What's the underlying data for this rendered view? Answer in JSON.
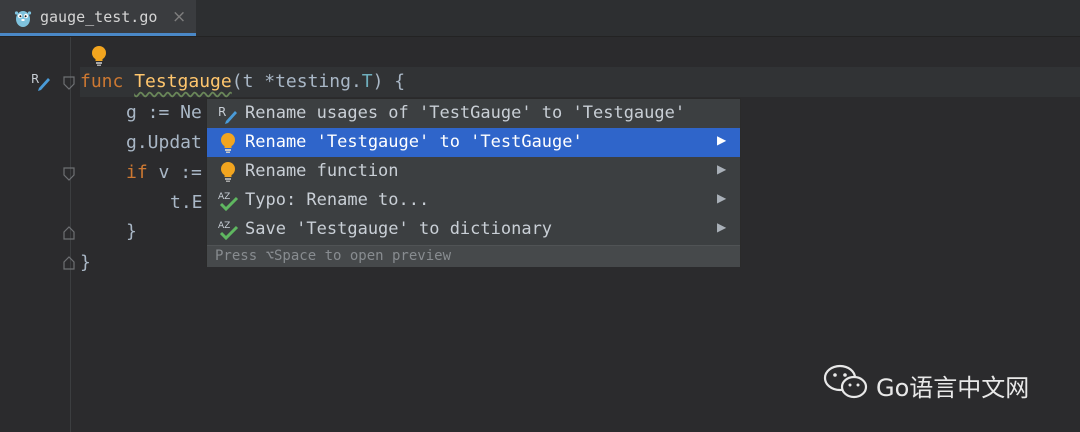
{
  "tab": {
    "filename": "gauge_test.go",
    "close_glyph": "×",
    "icon": "gopher-icon"
  },
  "editor": {
    "lines": {
      "l1_kw": "func ",
      "l1_fn": "Testgauge",
      "l1_a": "(t *testing.",
      "l1_ty": "T",
      "l1_b": ") {",
      "l2": "g := Ne",
      "l3": "g.Updat",
      "l4_kw": "if",
      "l4_rest": " v :=",
      "l5": "t.E",
      "l6": "}",
      "l7": "}"
    },
    "gutter_icons": [
      "lightbulb-icon",
      "rename-refactor-icon"
    ]
  },
  "popup": {
    "items": [
      {
        "label": "Rename usages of 'TestGauge' to 'Testgauge'",
        "icon": "rename-refactor-icon",
        "has_submenu": false,
        "selected": false
      },
      {
        "label": "Rename 'Testgauge' to 'TestGauge'",
        "icon": "lightbulb-icon",
        "has_submenu": true,
        "selected": true
      },
      {
        "label": "Rename function",
        "icon": "lightbulb-icon",
        "has_submenu": true,
        "selected": false
      },
      {
        "label": "Typo: Rename to...",
        "icon": "spellcheck-icon",
        "has_submenu": true,
        "selected": false
      },
      {
        "label": "Save 'Testgauge' to dictionary",
        "icon": "spellcheck-icon",
        "has_submenu": true,
        "selected": false
      }
    ],
    "arrow_glyph": "▶",
    "footer": "Press ⌥Space to open preview"
  },
  "watermark": {
    "text": "Go语言中文网",
    "icon": "wechat-icon"
  },
  "colors": {
    "background": "#2b2b2d",
    "selection": "#2f65ca",
    "keyword": "#cc7832",
    "function": "#ffc66d",
    "type": "#6fafbd",
    "text": "#a9b7c6"
  }
}
